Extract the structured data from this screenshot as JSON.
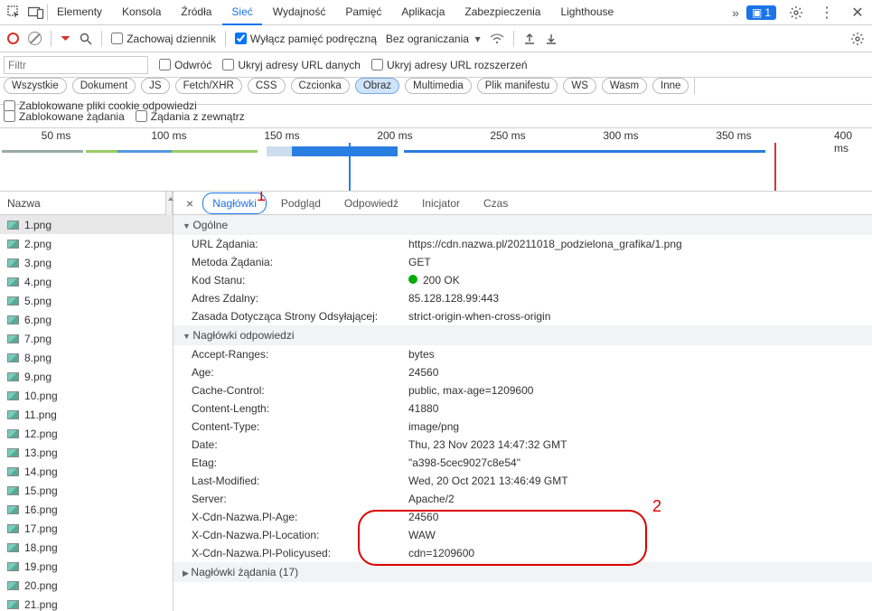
{
  "topTabs": [
    "Elementy",
    "Konsola",
    "Źródła",
    "Sieć",
    "Wydajność",
    "Pamięć",
    "Aplikacja",
    "Zabezpieczenia",
    "Lighthouse"
  ],
  "topActiveIndex": 3,
  "badgeCount": "1",
  "toolbar2": {
    "preserve": "Zachowaj dziennik",
    "disableCache": "Wyłącz pamięć podręczną",
    "throttling": "Bez ograniczania"
  },
  "filterRow": {
    "placeholder": "Filtr",
    "invert": "Odwróć",
    "hideData": "Ukryj adresy URL danych",
    "hideExt": "Ukryj adresy URL rozszerzeń"
  },
  "chips": [
    "Wszystkie",
    "Dokument",
    "JS",
    "Fetch/XHR",
    "CSS",
    "Czcionka",
    "Obraz",
    "Multimedia",
    "Plik manifestu",
    "WS",
    "Wasm",
    "Inne"
  ],
  "chipActiveIndex": 6,
  "blockedCookies": "Zablokowane pliki cookie odpowiedzi",
  "chipRow2": {
    "blocked": "Zablokowane żądania",
    "thirdParty": "Żądania z zewnątrz"
  },
  "timelineTicks": [
    "50 ms",
    "100 ms",
    "150 ms",
    "200 ms",
    "250 ms",
    "300 ms",
    "350 ms",
    "400 ms"
  ],
  "nameHeader": "Nazwa",
  "files": [
    "1.png",
    "2.png",
    "3.png",
    "4.png",
    "5.png",
    "6.png",
    "7.png",
    "8.png",
    "9.png",
    "10.png",
    "11.png",
    "12.png",
    "13.png",
    "14.png",
    "15.png",
    "16.png",
    "17.png",
    "18.png",
    "19.png",
    "20.png",
    "21.png"
  ],
  "detailTabs": [
    "Nagłówki",
    "Podgląd",
    "Odpowiedź",
    "Inicjator",
    "Czas"
  ],
  "detailActiveIndex": 0,
  "annot1": "1",
  "annot2": "2",
  "sections": {
    "general": "Ogólne",
    "respHeaders": "Nagłówki odpowiedzi",
    "reqHeaders": "Nagłówki żądania (17)"
  },
  "general": [
    {
      "k": "URL Żądania:",
      "v": "https://cdn.nazwa.pl/20211018_podzielona_grafika/1.png"
    },
    {
      "k": "Metoda Żądania:",
      "v": "GET"
    },
    {
      "k": "Kod Stanu:",
      "v": "200 OK",
      "dot": true
    },
    {
      "k": "Adres Zdalny:",
      "v": "85.128.128.99:443"
    },
    {
      "k": "Zasada Dotycząca Strony Odsyłającej:",
      "v": "strict-origin-when-cross-origin"
    }
  ],
  "respHeaders": [
    {
      "k": "Accept-Ranges:",
      "v": "bytes"
    },
    {
      "k": "Age:",
      "v": "24560"
    },
    {
      "k": "Cache-Control:",
      "v": "public, max-age=1209600"
    },
    {
      "k": "Content-Length:",
      "v": "41880"
    },
    {
      "k": "Content-Type:",
      "v": "image/png"
    },
    {
      "k": "Date:",
      "v": "Thu, 23 Nov 2023 14:47:32 GMT"
    },
    {
      "k": "Etag:",
      "v": "\"a398-5cec9027c8e54\""
    },
    {
      "k": "Last-Modified:",
      "v": "Wed, 20 Oct 2021 13:46:49 GMT"
    },
    {
      "k": "Server:",
      "v": "Apache/2"
    },
    {
      "k": "X-Cdn-Nazwa.Pl-Age:",
      "v": "24560"
    },
    {
      "k": "X-Cdn-Nazwa.Pl-Location:",
      "v": "WAW"
    },
    {
      "k": "X-Cdn-Nazwa.Pl-Policyused:",
      "v": "cdn=1209600"
    }
  ]
}
